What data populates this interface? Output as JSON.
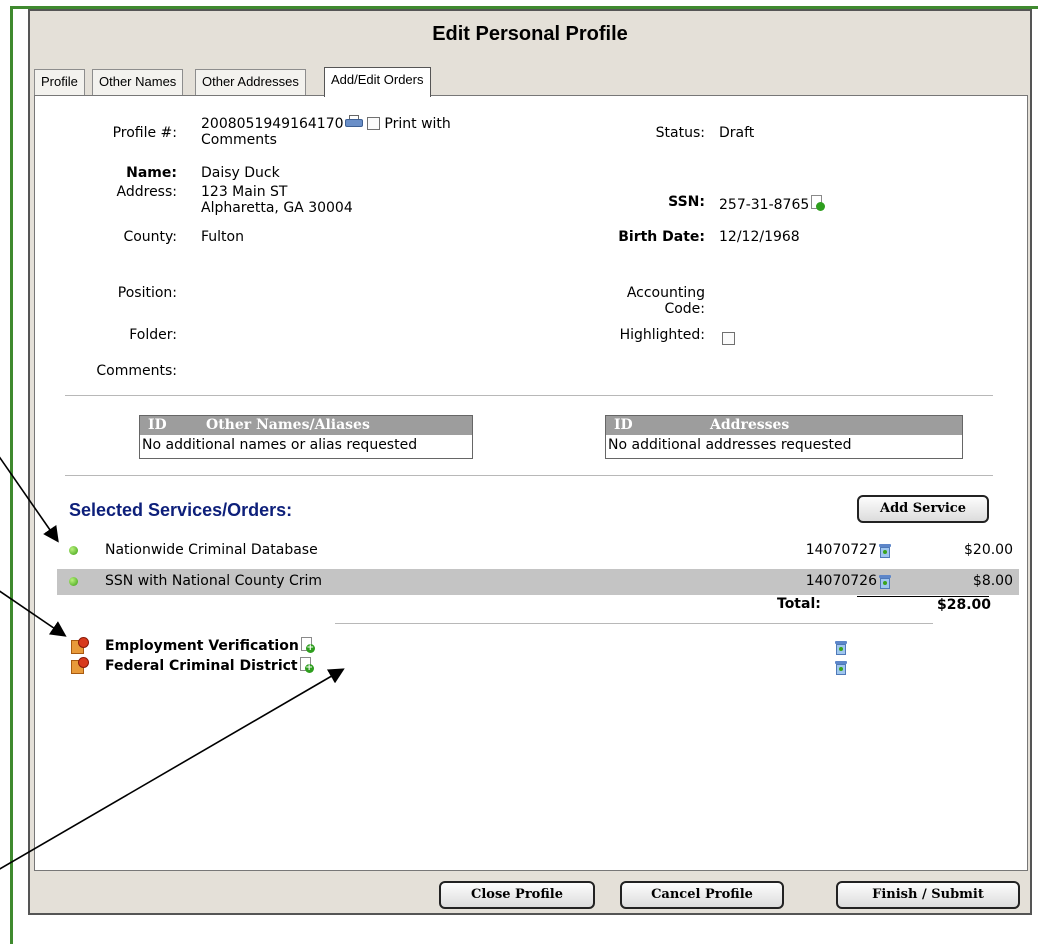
{
  "window": {
    "title": "Edit Personal Profile"
  },
  "tabs": [
    {
      "label": "Profile"
    },
    {
      "label": "Other Names"
    },
    {
      "label": "Other Addresses"
    },
    {
      "label": "Add/Edit Orders"
    }
  ],
  "active_tab": "Add/Edit Orders",
  "profile": {
    "profile_num_label": "Profile #:",
    "profile_num": "2008051949164170",
    "print_comments_label_1": "Print with",
    "print_comments_label_2": "Comments",
    "print_comments_checked": false,
    "status_label": "Status:",
    "status": "Draft",
    "name_label": "Name:",
    "name": "Daisy Duck",
    "address_label": "Address:",
    "address_line1": "123 Main ST",
    "address_line2": "Alpharetta, GA 30004",
    "ssn_label": "SSN:",
    "ssn": "257-31-8765",
    "county_label": "County:",
    "county": "Fulton",
    "birth_date_label": "Birth Date:",
    "birth_date": "12/12/1968",
    "position_label": "Position:",
    "position": "",
    "accounting_label_1": "Accounting",
    "accounting_label_2": "Code:",
    "accounting_code": "",
    "folder_label": "Folder:",
    "folder": "",
    "highlighted_label": "Highlighted:",
    "highlighted_checked": false,
    "comments_label": "Comments:",
    "comments": ""
  },
  "aliases_table": {
    "col_id": "ID",
    "col_name": "Other Names/Aliases",
    "empty_text": "No additional names or alias requested"
  },
  "addresses_table": {
    "col_id": "ID",
    "col_name": "Addresses",
    "empty_text": "No additional addresses requested"
  },
  "services": {
    "heading": "Selected Services/Orders:",
    "add_button": "Add Service",
    "rows": [
      {
        "name": "Nationwide Criminal Database",
        "id": "14070727",
        "price": "$20.00"
      },
      {
        "name": "SSN with National County Crim",
        "id": "14070726",
        "price": "$8.00"
      }
    ],
    "total_label": "Total:",
    "total": "$28.00",
    "pending": [
      {
        "name": "Employment Verification"
      },
      {
        "name": "Federal Criminal District"
      }
    ]
  },
  "footer": {
    "close_button": "Close Profile",
    "cancel_button": "Cancel Profile",
    "finish_button": "Finish / Submit"
  },
  "colors": {
    "frame_green": "#3f8a2f",
    "heading_blue": "#0d1f7a",
    "panel_bg": "#e4e0d8"
  }
}
